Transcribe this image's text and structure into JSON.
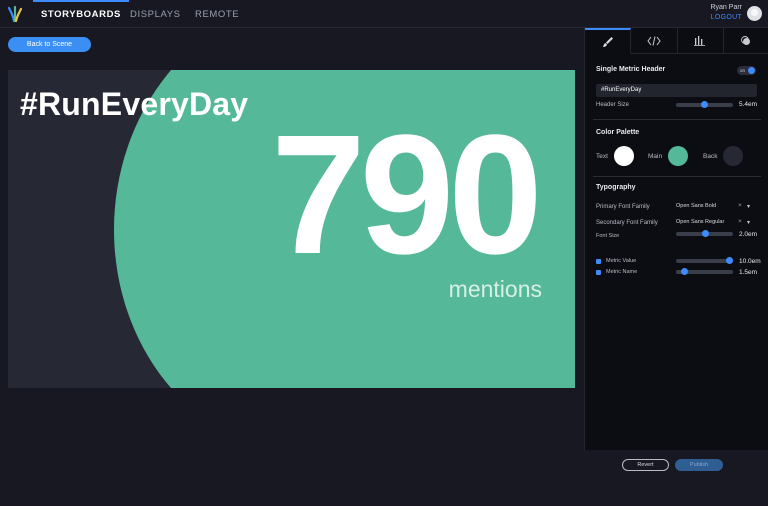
{
  "nav": {
    "tabs": [
      {
        "label": "STORYBOARDS",
        "active": true
      },
      {
        "label": "DISPLAYS",
        "active": false
      },
      {
        "label": "REMOTE",
        "active": false
      }
    ],
    "user_name": "Ryan Parr",
    "logout_label": "LOGOUT"
  },
  "back_button_label": "Back to Scene",
  "preview": {
    "header": "#RunEveryDay",
    "metric_value": "790",
    "metric_name": "mentions",
    "colors": {
      "main": "#55b898",
      "back": "#262834",
      "text": "#ffffff"
    }
  },
  "panel": {
    "tabs": [
      {
        "icon": "brush-icon",
        "active": true
      },
      {
        "icon": "code-icon",
        "active": false
      },
      {
        "icon": "bar-chart-icon",
        "active": false
      },
      {
        "icon": "layers-icon",
        "active": false
      }
    ],
    "single_metric_header": {
      "title": "Single Metric Header",
      "toggle_label": "on",
      "toggle_on": true,
      "header_text": "#RunEveryDay",
      "header_size_label": "Header Size",
      "header_size_value": "5.4em",
      "header_size_fraction": 0.5
    },
    "color_palette": {
      "title": "Color Palette",
      "swatches": [
        {
          "label": "Text",
          "color": "#ffffff"
        },
        {
          "label": "Main",
          "color": "#55b898"
        },
        {
          "label": "Back",
          "color": "#262834"
        }
      ]
    },
    "typography": {
      "title": "Typography",
      "primary_font_label": "Primary Font Family",
      "primary_font_value": "Open Sans Bold",
      "secondary_font_label": "Secondary Font Family",
      "secondary_font_value": "Open Sans Regular",
      "font_size_label": "Font Size",
      "font_size_value": "2.0em",
      "font_size_fraction": 0.52,
      "metric_value_label": "Metric Value",
      "metric_value_value": "10.0em",
      "metric_value_fraction": 1.0,
      "metric_name_label": "Metric Name",
      "metric_name_value": "1.5em",
      "metric_name_fraction": 0.1
    }
  },
  "revert_label": "Revert",
  "publish_label": "Publish"
}
